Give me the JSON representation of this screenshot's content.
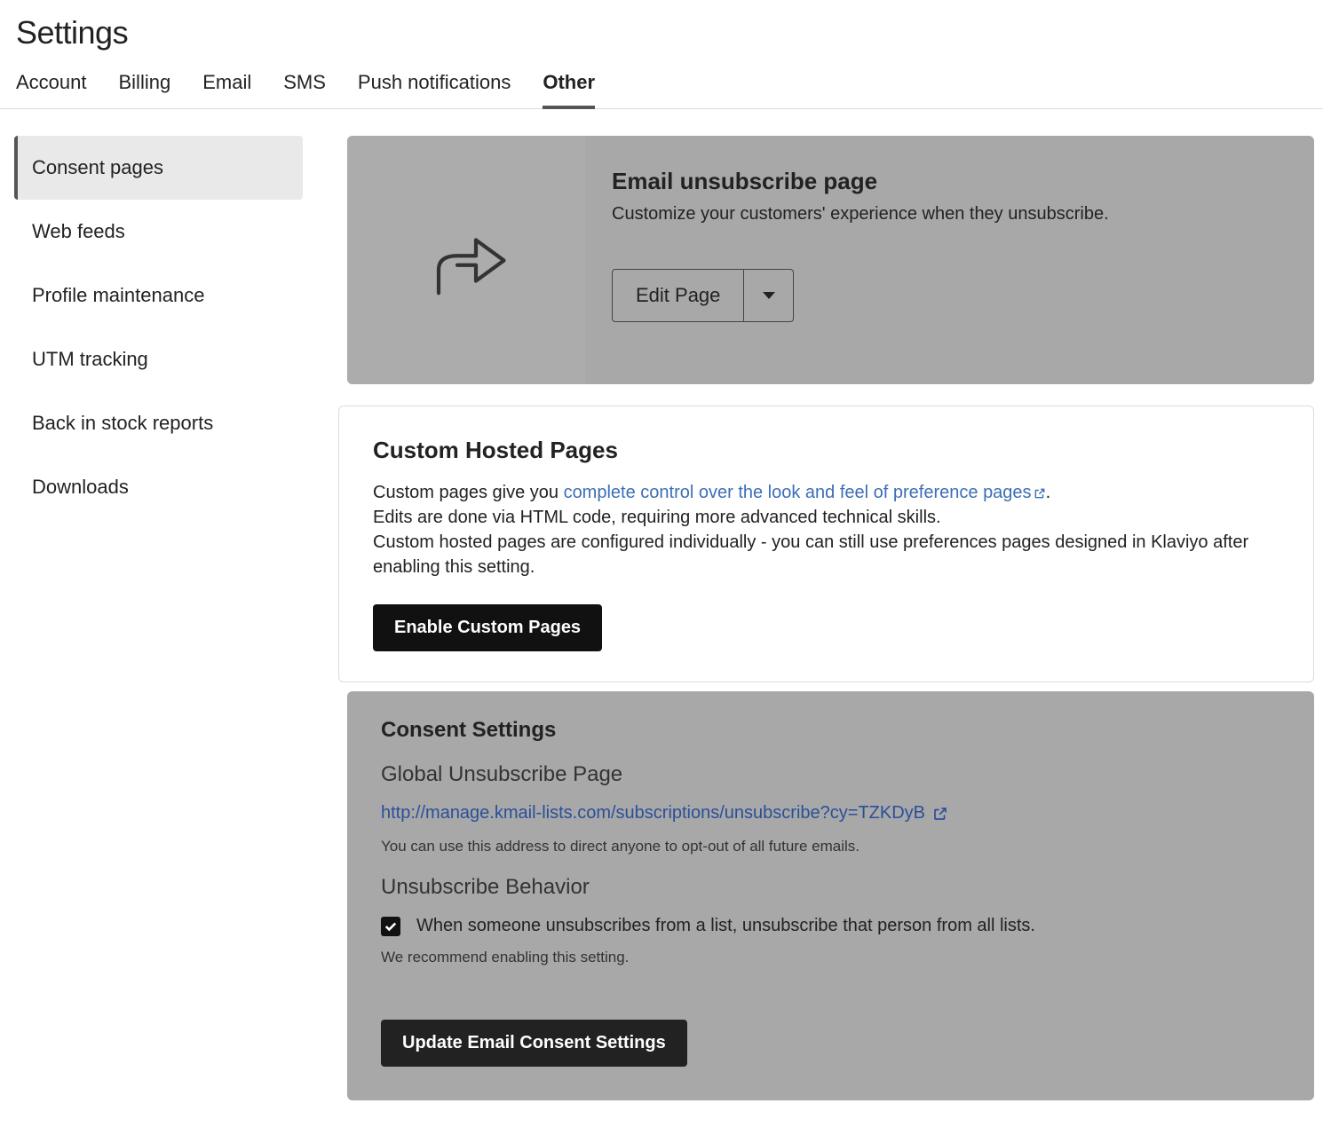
{
  "page_title": "Settings",
  "tabs": [
    "Account",
    "Billing",
    "Email",
    "SMS",
    "Push notifications",
    "Other"
  ],
  "active_tab_index": 5,
  "sidebar": {
    "items": [
      "Consent pages",
      "Web feeds",
      "Profile maintenance",
      "UTM tracking",
      "Back in stock reports",
      "Downloads"
    ],
    "active_index": 0
  },
  "unsubscribe_card": {
    "title": "Email unsubscribe page",
    "subtitle": "Customize your customers' experience when they unsubscribe.",
    "edit_button": "Edit Page"
  },
  "custom_hosted": {
    "title": "Custom Hosted Pages",
    "lead": "Custom pages give you ",
    "link_text": "complete control over the look and feel of preference pages",
    "after_link": ".",
    "line2": "Edits are done via HTML code, requiring more advanced technical skills.",
    "line3": "Custom hosted pages are configured individually - you can still use preferences pages designed in Klaviyo after enabling this setting.",
    "button": "Enable Custom Pages"
  },
  "consent_settings": {
    "title": "Consent Settings",
    "global_heading": "Global Unsubscribe Page",
    "url": "http://manage.kmail-lists.com/subscriptions/unsubscribe?cy=TZKDyB",
    "url_help": "You can use this address to direct anyone to opt-out of all future emails.",
    "behavior_heading": "Unsubscribe Behavior",
    "checkbox_label": "When someone unsubscribes from a list, unsubscribe that person from all lists.",
    "checkbox_checked": true,
    "recommend": "We recommend enabling this setting.",
    "update_button": "Update Email Consent Settings"
  }
}
